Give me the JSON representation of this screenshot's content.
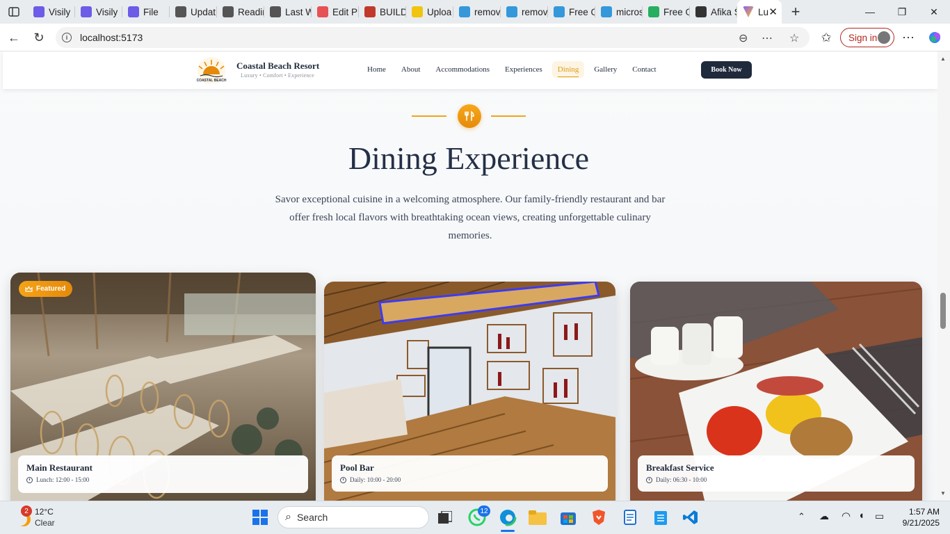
{
  "browser": {
    "tabs": [
      {
        "label": "Visily",
        "color": "#6c5ce7"
      },
      {
        "label": "Visily",
        "color": "#6c5ce7"
      },
      {
        "label": "File",
        "color": "#6c5ce7"
      },
      {
        "label": "Updat",
        "color": "#555555"
      },
      {
        "label": "Readin",
        "color": "#555555"
      },
      {
        "label": "Last W",
        "color": "#555555"
      },
      {
        "label": "Edit PD",
        "color": "#e55353"
      },
      {
        "label": "BUILD",
        "color": "#c0392b"
      },
      {
        "label": "Uploa",
        "color": "#f1c40f"
      },
      {
        "label": "remov",
        "color": "#3498db"
      },
      {
        "label": "remov",
        "color": "#3498db"
      },
      {
        "label": "Free O",
        "color": "#3498db"
      },
      {
        "label": "micros",
        "color": "#3498db"
      },
      {
        "label": "Free O",
        "color": "#27ae60"
      },
      {
        "label": "Afika S",
        "color": "#333333"
      }
    ],
    "active_tab": {
      "label": "Lu",
      "color": "#8b5cf6"
    },
    "url": "localhost:5173",
    "signin_label": "Sign in"
  },
  "site": {
    "brand_name": "Coastal Beach Resort",
    "brand_tagline": "Luxury • Comfort • Experience",
    "logo_text": "COASTAL BEACH",
    "nav": [
      "Home",
      "About",
      "Accommodations",
      "Experiences",
      "Dining",
      "Gallery",
      "Contact"
    ],
    "active_nav": "Dining",
    "book_label": "Book Now"
  },
  "section": {
    "title": "Dining Experience",
    "description": "Savor exceptional cuisine in a welcoming atmosphere. Our family-friendly restaurant and bar offer fresh local flavors with breathtaking ocean views, creating unforgettable culinary memories."
  },
  "cards": [
    {
      "name": "Main Restaurant",
      "hours": "Lunch: 12:00 - 15:00",
      "badge": "Featured"
    },
    {
      "name": "Pool Bar",
      "hours": "Daily: 10:00 - 20:00"
    },
    {
      "name": "Breakfast Service",
      "hours": "Daily: 06:30 - 10:00"
    }
  ],
  "taskbar": {
    "weather_temp": "12°C",
    "weather_desc": "Clear",
    "weather_badge": "2",
    "search_placeholder": "Search",
    "whatsapp_badge": "12",
    "time": "1:57 AM",
    "date": "9/21/2025"
  },
  "colors": {
    "accent": "#e09a0c",
    "navy": "#1f2a3c"
  }
}
